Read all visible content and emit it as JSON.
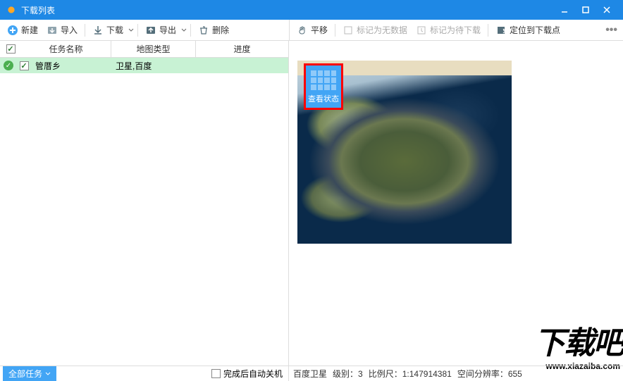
{
  "window": {
    "title": "下载列表"
  },
  "toolbar_left": {
    "new": "新建",
    "import": "导入",
    "download": "下载",
    "export": "导出",
    "delete": "删除"
  },
  "toolbar_right": {
    "pan": "平移",
    "mark_nodata": "标记为无数据",
    "mark_todownload": "标记为待下载",
    "locate": "定位到下载点",
    "more": "•••"
  },
  "table": {
    "headers": {
      "name": "任务名称",
      "type": "地图类型",
      "progress": "进度"
    },
    "rows": [
      {
        "name": "管厝乡",
        "type": "卫星,百度",
        "status": "done",
        "checked": true
      }
    ]
  },
  "view_button": {
    "label": "查看状态"
  },
  "footer": {
    "all_tasks": "全部任务",
    "auto_shutdown": "完成后自动关机"
  },
  "statusbar": {
    "source": "百度卫星",
    "level_label": "级别：",
    "level": "3",
    "scale_label": "比例尺：",
    "scale": "1:147914381",
    "res_label": "空间分辨率：",
    "res": "655"
  },
  "watermark": {
    "text": "下载吧",
    "url": "www.xiazaiba.com"
  }
}
